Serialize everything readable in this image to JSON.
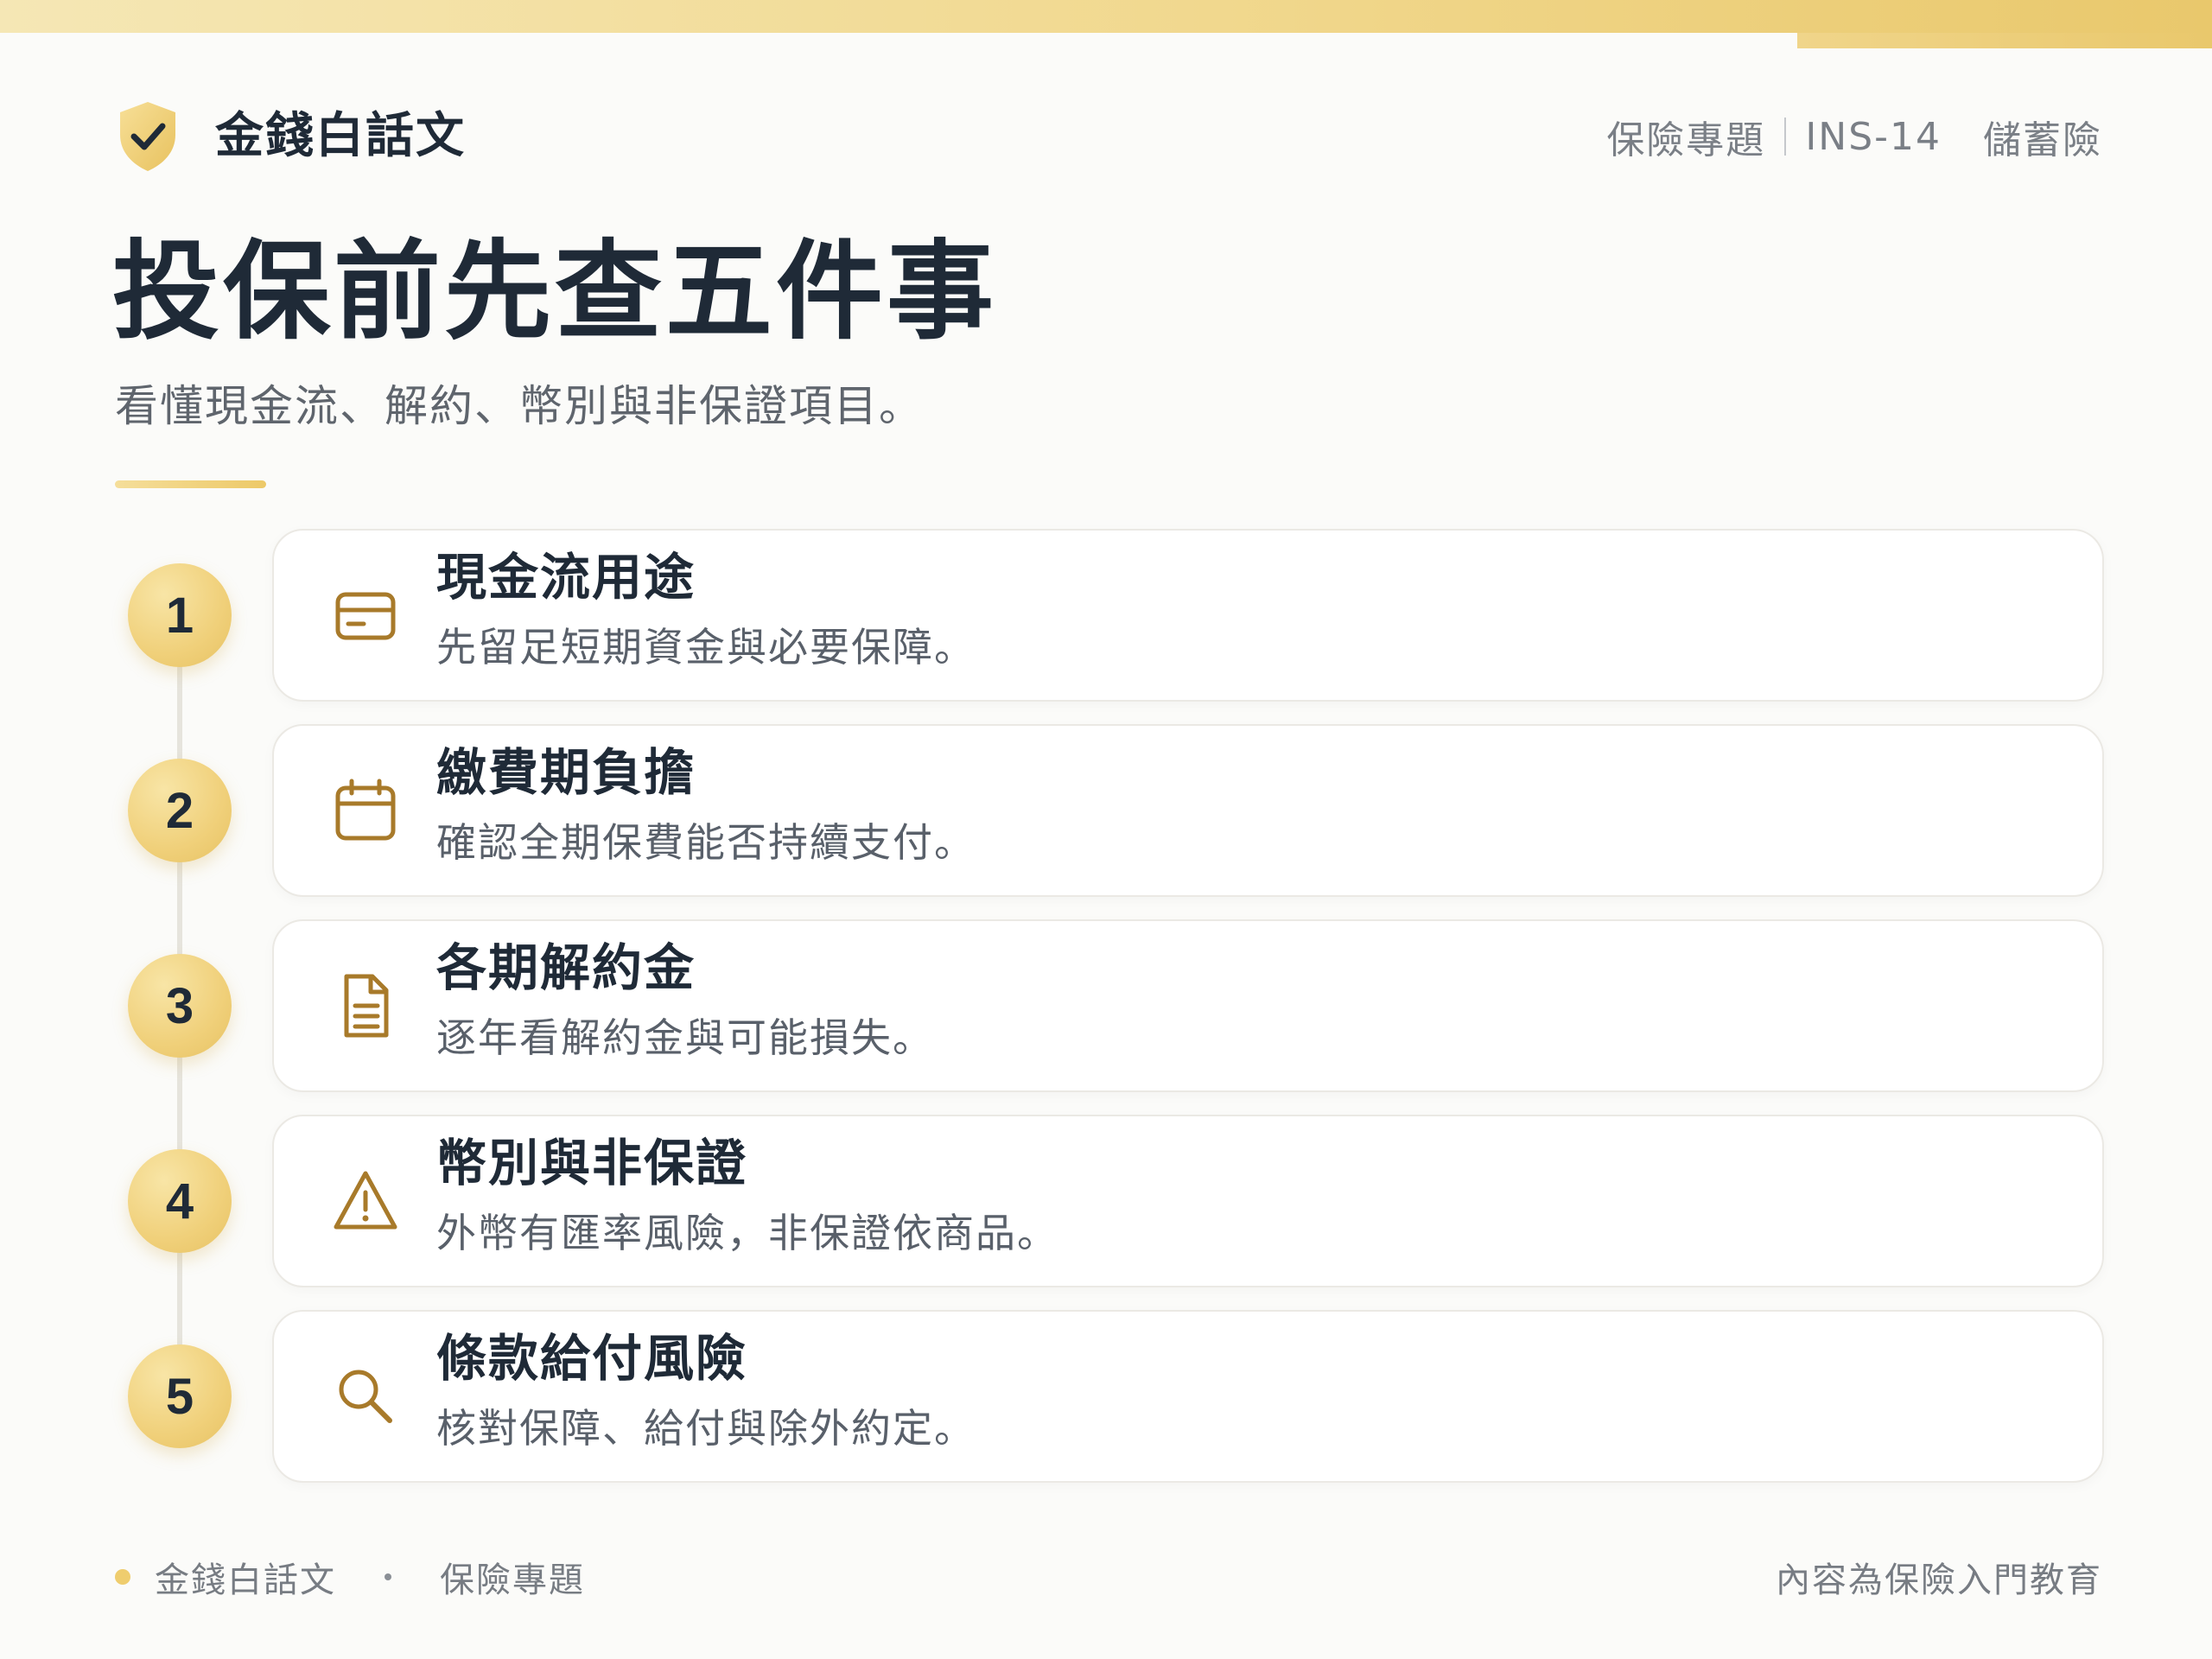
{
  "header": {
    "brand": "金錢白話文",
    "meta": {
      "category": "保險專題",
      "code": "INS-14",
      "topic": "儲蓄險"
    }
  },
  "title": "投保前先查五件事",
  "subtitle": "看懂現金流、解約、幣別與非保證項目。",
  "steps": [
    {
      "number": "1",
      "title": "現金流用途",
      "desc": "先留足短期資金與必要保障。",
      "icon": "credit-card-icon"
    },
    {
      "number": "2",
      "title": "繳費期負擔",
      "desc": "確認全期保費能否持續支付。",
      "icon": "calendar-icon"
    },
    {
      "number": "3",
      "title": "各期解約金",
      "desc": "逐年看解約金與可能損失。",
      "icon": "document-icon"
    },
    {
      "number": "4",
      "title": "幣別與非保證",
      "desc": "外幣有匯率風險，非保證依商品。",
      "icon": "warning-icon"
    },
    {
      "number": "5",
      "title": "條款給付風險",
      "desc": "核對保障、給付與除外約定。",
      "icon": "search-icon"
    }
  ],
  "footer": {
    "brand": "金錢白話文",
    "category": "保險專題",
    "note": "內容為保險入門教育"
  },
  "colors": {
    "accent": "#efcd6e",
    "icon": "#a87a2a",
    "text": "#1f2a37"
  }
}
